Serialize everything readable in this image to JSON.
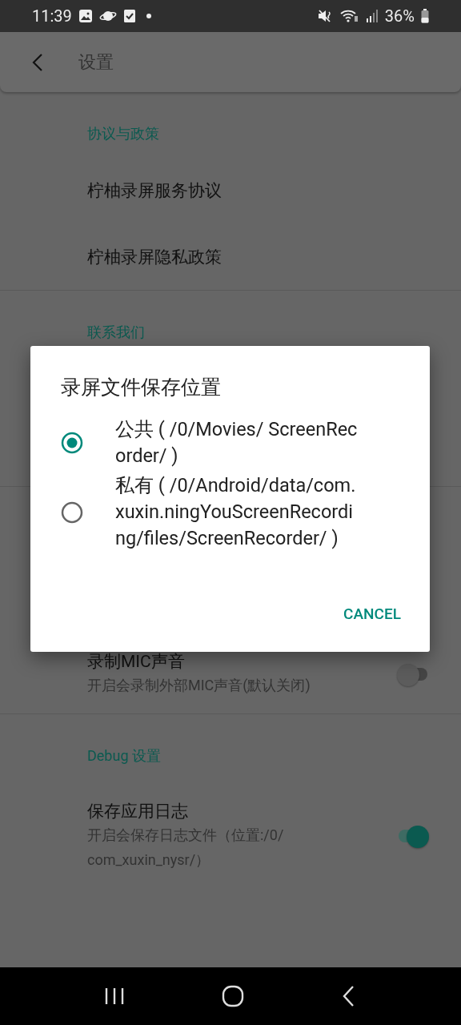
{
  "status_bar": {
    "time": "11:39",
    "battery": "36%"
  },
  "app_bar": {
    "title": "设置"
  },
  "sections": [
    {
      "header": "协议与政策",
      "items": [
        {
          "kind": "link",
          "title": "柠柚录屏服务协议"
        },
        {
          "kind": "link",
          "title": "柠柚录屏隐私政策"
        }
      ]
    },
    {
      "header": "联系我们"
    },
    {
      "items": [
        {
          "kind": "switch",
          "title": "录制MIC声音",
          "subtitle": "开启会录制外部MIC声音(默认关闭)",
          "on": false
        }
      ]
    },
    {
      "header": "Debug 设置",
      "items": [
        {
          "kind": "switch",
          "title": "保存应用日志",
          "subtitle": "开启会保存日志文件（位置:/0/\ncom_xuxin_nysr/）",
          "on": true
        }
      ]
    }
  ],
  "dialog": {
    "title": "录屏文件保存位置",
    "options": [
      {
        "label": "公共 ( /0/Movies/ ScreenRecorder/ )",
        "selected": true
      },
      {
        "label": "私有 ( /0/Android/data/com.xuxin.ningYouScreenRecording/files/ScreenRecorder/ )",
        "selected": false
      }
    ],
    "buttons": [
      "CANCEL"
    ]
  }
}
